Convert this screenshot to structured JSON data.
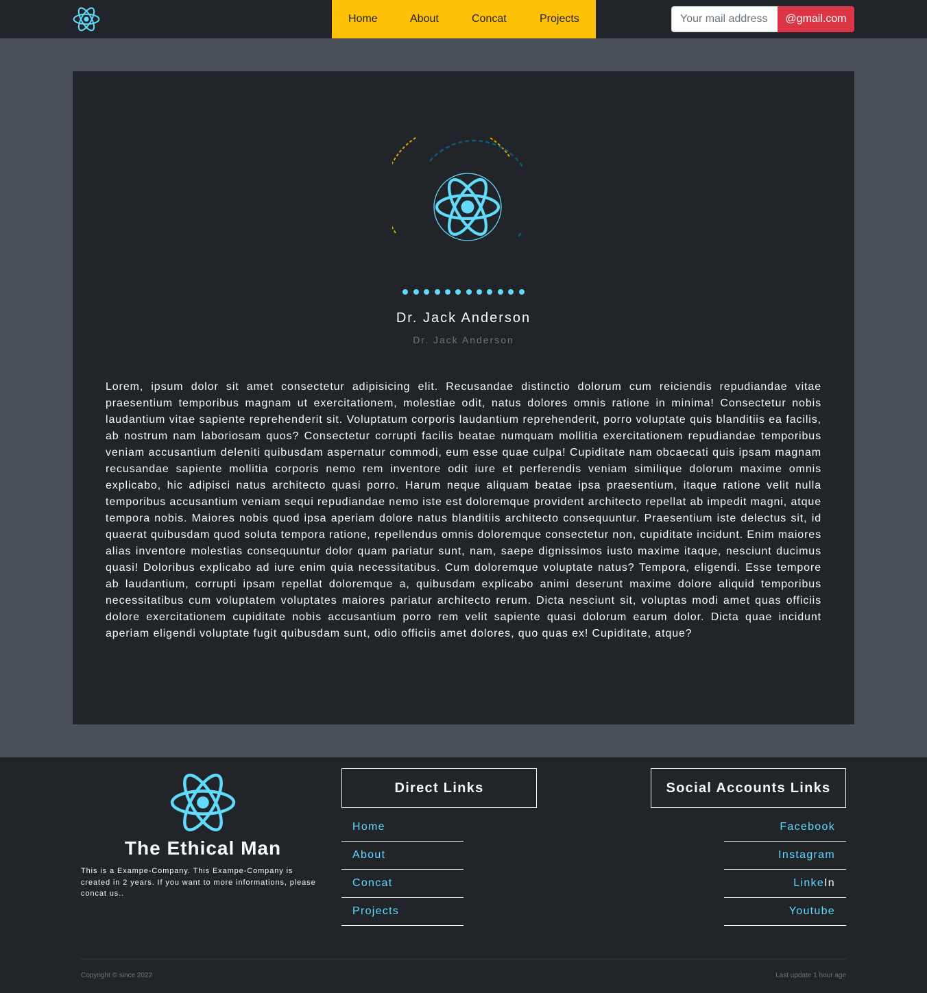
{
  "header": {
    "brand_icon": "react-atom-icon",
    "nav": [
      {
        "label": "Home"
      },
      {
        "label": "About"
      },
      {
        "label": "Concat"
      },
      {
        "label": "Projects"
      }
    ],
    "email_placeholder": "Your mail address",
    "email_domain_button": "@gmail.com"
  },
  "profile": {
    "avatar_icon": "react-atom-icon",
    "dot_count": 12,
    "name": "Dr. Jack Anderson",
    "subtitle": "Dr. Jack Anderson",
    "bio": "Lorem, ipsum dolor sit amet consectetur adipisicing elit. Recusandae distinctio dolorum cum reiciendis repudiandae vitae praesentium temporibus magnam ut exercitationem, molestiae odit, natus dolores omnis ratione in minima! Consectetur nobis laudantium vitae sapiente reprehenderit sit. Voluptatum corporis laudantium reprehenderit, porro voluptate quis blanditiis ea facilis, ab nostrum nam laboriosam quos? Consectetur corrupti facilis beatae numquam mollitia exercitationem repudiandae temporibus veniam accusantium deleniti quibusdam aspernatur commodi, eum esse quae culpa! Cupiditate nam obcaecati quis ipsam magnam recusandae sapiente mollitia corporis nemo rem inventore odit iure et perferendis veniam similique dolorum maxime omnis explicabo, hic adipisci natus architecto quasi porro. Harum neque aliquam beatae ipsa praesentium, itaque ratione velit nulla temporibus accusantium veniam sequi repudiandae nemo iste est doloremque provident architecto repellat ab impedit magni, atque tempora nobis. Maiores nobis quod ipsa aperiam dolore natus blanditiis architecto consequuntur. Praesentium iste delectus sit, id quaerat quibusdam quod soluta tempora ratione, repellendus omnis doloremque consectetur non, cupiditate incidunt. Enim maiores alias inventore molestias consequuntur dolor quam pariatur sunt, nam, saepe dignissimos iusto maxime itaque, nesciunt ducimus quasi! Doloribus explicabo ad iure enim quia necessitatibus. Cum doloremque voluptate natus? Tempora, eligendi. Esse tempore ab laudantium, corrupti ipsam repellat doloremque a, quibusdam explicabo animi deserunt maxime dolore aliquid temporibus necessitatibus cum voluptatem voluptates maiores pariatur architecto rerum. Dicta nesciunt sit, voluptas modi amet quas officiis dolore exercitationem cupiditate nobis accusantium porro rem velit sapiente quasi dolorum earum dolor. Dicta quae incidunt aperiam eligendi voluptate fugit quibusdam sunt, odio officiis amet dolores, quo quas ex! Cupiditate, atque?"
  },
  "footer": {
    "logo_icon": "react-atom-icon",
    "title": "The Ethical Man",
    "description": "This is a Exampe-Company. This Exampe-Company is created in 2 years. If you want to more informations, please concat us..",
    "direct_links_title": "Direct Links",
    "direct_links": [
      {
        "label": "Home"
      },
      {
        "label": "About"
      },
      {
        "label": "Concat"
      },
      {
        "label": "Projects"
      }
    ],
    "social_title": "Social Accounts Links",
    "social_links": [
      {
        "label": "Facebook",
        "tail": ""
      },
      {
        "label": "Instagram",
        "tail": ""
      },
      {
        "label": "Linke",
        "tail": "In"
      },
      {
        "label": "Youtube",
        "tail": ""
      }
    ],
    "copyright": "Copyright © since 2022",
    "last_update": "Last update 1 hour age"
  },
  "colors": {
    "page_bg": "#495057",
    "dark_bg": "#212529",
    "nav_bg": "#ffc107",
    "accent": "#61dafb",
    "button_red": "#dc3545",
    "ring_yellow": "#e0a800",
    "ring_blue": "#0d5c75"
  }
}
